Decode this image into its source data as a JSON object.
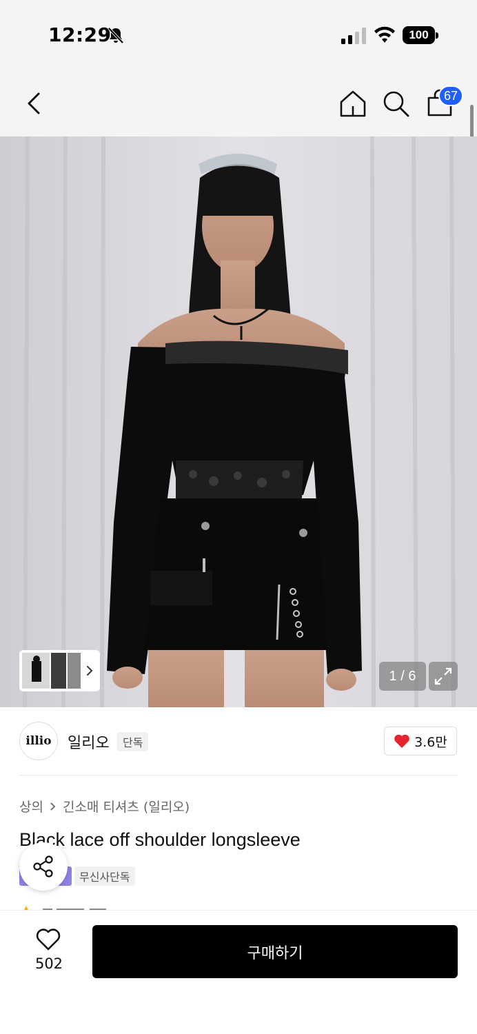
{
  "status_bar": {
    "time": "12:29",
    "battery": "100"
  },
  "header": {
    "cart_count": "67"
  },
  "gallery": {
    "counter": "1 / 6",
    "current": 1,
    "total": 6
  },
  "brand": {
    "logo_text": "illio",
    "name": "일리오",
    "tag": "단독",
    "likes": "3.6만",
    "like_color": "#e8232e"
  },
  "breadcrumb": {
    "category": "상의",
    "subcategory": "긴소매 티셔츠 (일리오)"
  },
  "product": {
    "title": "Black lace off shoulder longsleeve",
    "badge": "무신사단독"
  },
  "bottom_bar": {
    "wish_count": "502",
    "buy_label": "구매하기"
  },
  "colors": {
    "accent": "#1f5eff",
    "badge_purple": "#8e83e6",
    "buy_button": "#000000"
  }
}
